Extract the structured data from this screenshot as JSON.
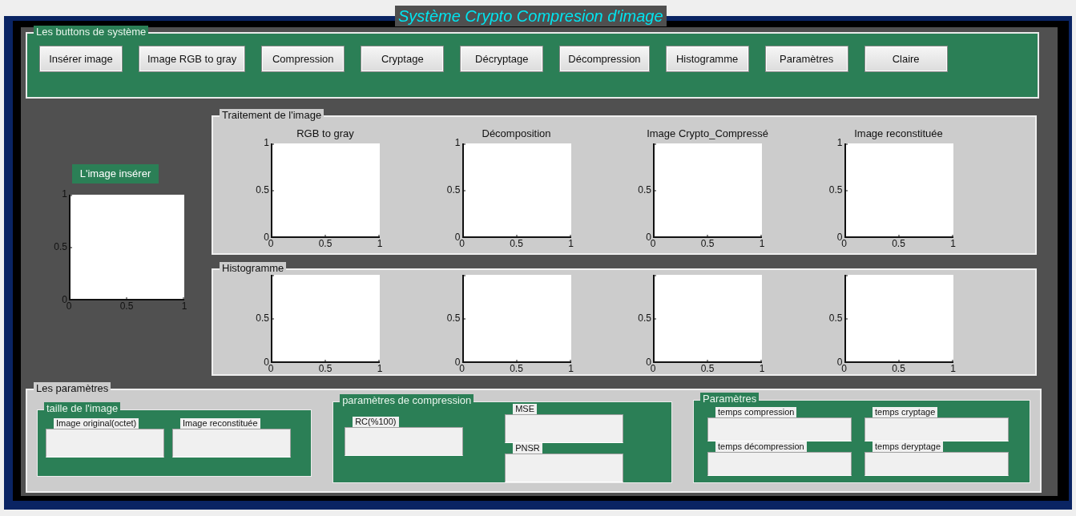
{
  "window": {
    "title": "Système Crypto Compresion d'image"
  },
  "buttons_panel": {
    "title": "Les buttons de système",
    "buttons": [
      "Insérer image",
      "Image RGB to gray",
      "Compression",
      "Cryptage",
      "Décryptage",
      "Décompression",
      "Histogramme",
      "Paramètres",
      "Claire"
    ]
  },
  "input_image": {
    "label": "L'image insérer",
    "yticks": [
      "1",
      "0.5",
      "0"
    ],
    "xticks": [
      "0",
      "0.5",
      "1"
    ]
  },
  "processing": {
    "title": "Traitement de l'image",
    "axes": [
      {
        "title": "RGB to gray",
        "yticks": [
          "1",
          "0.5",
          "0"
        ],
        "xticks": [
          "0",
          "0.5",
          "1"
        ]
      },
      {
        "title": "Décomposition",
        "yticks": [
          "1",
          "0.5",
          "0"
        ],
        "xticks": [
          "0",
          "0.5",
          "1"
        ]
      },
      {
        "title": "Image Crypto_Compressé",
        "yticks": [
          "0.5",
          "0"
        ],
        "xticks": [
          "0",
          "0.5",
          "1"
        ]
      },
      {
        "title": "Image reconstituée",
        "yticks": [
          "1",
          "0.5",
          "0"
        ],
        "xticks": [
          "0",
          "0.5",
          "1"
        ]
      }
    ]
  },
  "histogram": {
    "title": "Histogramme",
    "axes": [
      {
        "yticks": [
          "0.5",
          "0"
        ],
        "xticks": [
          "0",
          "0.5",
          "1"
        ]
      },
      {
        "yticks": [
          "0.5",
          "0"
        ],
        "xticks": [
          "0",
          "0.5",
          "1"
        ]
      },
      {
        "yticks": [
          "0.5",
          "0"
        ],
        "xticks": [
          "0",
          "0.5",
          "1"
        ]
      },
      {
        "yticks": [
          "0.5",
          "0"
        ],
        "xticks": [
          "0",
          "0.5",
          "1"
        ]
      }
    ]
  },
  "parameters": {
    "title": "Les paramètres",
    "groups": [
      {
        "title": "taille de l'image",
        "kind": "row",
        "fields": [
          {
            "label": "Image original(octet)"
          },
          {
            "label": "Image reconstituée"
          }
        ]
      },
      {
        "title": "paramètres de compression",
        "kind": "split",
        "fields": [
          {
            "label": "RC(%100)"
          },
          {
            "label": "MSE"
          },
          {
            "label": "PNSR"
          }
        ]
      },
      {
        "title": "Paramètres",
        "kind": "grid",
        "fields": [
          {
            "label": "temps compression"
          },
          {
            "label": "temps cryptage"
          },
          {
            "label": "temps décompression"
          },
          {
            "label": "temps deryptage"
          }
        ]
      }
    ]
  }
}
